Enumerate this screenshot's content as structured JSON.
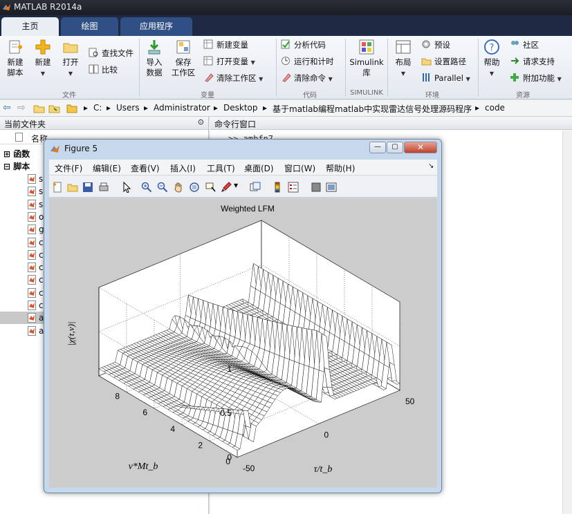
{
  "app": {
    "title": "MATLAB R2014a"
  },
  "tabs": [
    {
      "label": "主页",
      "active": true
    },
    {
      "label": "绘图",
      "active": false
    },
    {
      "label": "应用程序",
      "active": false
    }
  ],
  "ribbon": {
    "new_script": "新建\n脚本",
    "new": "新建",
    "open": "打开",
    "find_files": "查找文件",
    "compare": "比较",
    "group_file": "文件",
    "import_data": "导入\n数据",
    "save_workspace": "保存\n工作区",
    "new_variable": "新建变量",
    "open_variable": "打开变量",
    "clear_workspace": "清除工作区",
    "group_variable": "变量",
    "analyze_code": "分析代码",
    "run_and_time": "运行和计时",
    "clear_commands": "清除命令",
    "group_code": "代码",
    "simulink": "Simulink\n库",
    "group_simulink": "SIMULINK",
    "layout": "布局",
    "preferences": "预设",
    "set_path": "设置路径",
    "parallel": "Parallel",
    "group_environment": "环境",
    "help": "帮助",
    "community": "社区",
    "request_support": "请求支持",
    "addons": "附加功能",
    "group_resources": "资源"
  },
  "address": {
    "crumbs": [
      "C:",
      "Users",
      "Administrator",
      "Desktop",
      "基于matlab编程matlab中实现雷达信号处理源码程序",
      "code"
    ]
  },
  "current_folder": {
    "title": "当前文件夹",
    "col_name": "名称",
    "groups": [
      "函数",
      "脚本"
    ],
    "files": [
      "s",
      "s",
      "s",
      "o",
      "g",
      "c",
      "c",
      "c",
      "c",
      "c",
      "c",
      "a",
      "a"
    ]
  },
  "command_window": {
    "title": "命令行窗口",
    "text": ">> ambfn7"
  },
  "figure": {
    "window_title": "Figure 5",
    "menus": [
      "文件(F)",
      "编辑(E)",
      "查看(V)",
      "插入(I)",
      "工具(T)",
      "桌面(D)",
      "窗口(W)",
      "帮助(H)"
    ],
    "toolbar_icons": [
      "new-figure-icon",
      "open-file-icon",
      "save-icon",
      "print-icon",
      "pointer-icon",
      "zoom-in-icon",
      "zoom-out-icon",
      "pan-hand-icon",
      "rotate-3d-icon",
      "data-cursor-icon",
      "brush-icon",
      "link-icon",
      "colorbar-icon",
      "legend-icon",
      "hide-plot-tools-icon",
      "show-plot-tools-icon"
    ]
  },
  "chart_data": {
    "type": "surface",
    "title": "Weighted LFM",
    "xlabel": "τ/t_b",
    "ylabel": "ν*Mt_b",
    "zlabel": "|χ(τ,ν)|",
    "xticks": [
      "-50",
      "0",
      "50"
    ],
    "yticks": [
      "0",
      "2",
      "4",
      "6",
      "8"
    ],
    "zticks": [
      "0",
      "0.5",
      "1"
    ],
    "xlim": [
      -50,
      50
    ],
    "ylim": [
      0,
      10
    ],
    "zlim": [
      0,
      1
    ],
    "grid": true,
    "colors": {
      "mesh": "#000000",
      "face": "#ffffff",
      "background": "#cccccc"
    }
  }
}
